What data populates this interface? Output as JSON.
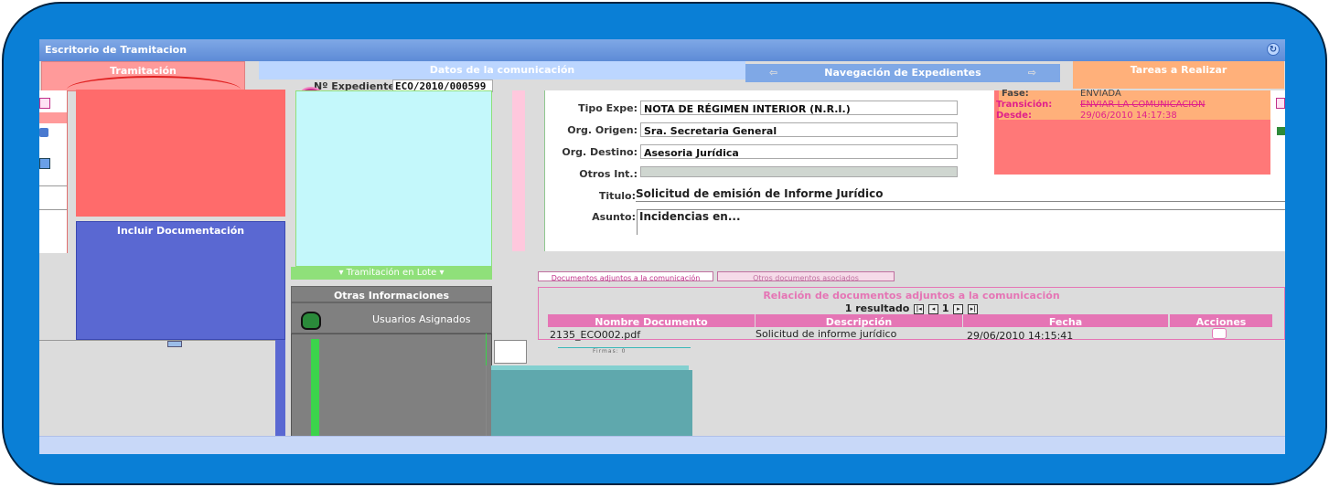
{
  "window": {
    "title": "Escritorio de Tramitacion"
  },
  "panels": {
    "tramitacion": "Tramitación",
    "datos": "Datos de la comunicación",
    "navegacion": "Navegación de Expedientes",
    "tareas": "Tareas a Realizar",
    "incluir": "Incluir Documentación",
    "lote": "▾ Tramitación en Lote ▾",
    "otras": "Otras Informaciones",
    "usuarios": "Usuarios Asignados"
  },
  "expediente": {
    "label": "Nº Expediente:",
    "value": "ECO/2010/000599"
  },
  "form": {
    "tipo_label": "Tipo Expe:",
    "tipo_value": "NOTA DE RÉGIMEN INTERIOR (N.R.I.)",
    "origen_label": "Org. Origen:",
    "origen_value": "Sra. Secretaria General",
    "destino_label": "Org. Destino:",
    "destino_value": "Asesoria Jurídica",
    "otros_label": "Otros Int.:",
    "otros_value": "",
    "titulo_label": "Titulo:",
    "titulo_value": "Solicitud de emisión de Informe Jurídico",
    "asunto_label": "Asunto:",
    "asunto_value": "Incidencias en..."
  },
  "tareas": {
    "fase_label": "Fase:",
    "fase_value": "ENVIADA",
    "transicion_label": "Transición:",
    "transicion_value": "ENVIAR LA COMUNICACION",
    "desde_label": "Desde:",
    "desde_value": "29/06/2010 14:17:38"
  },
  "docs": {
    "tab1": "Documentos adjuntos a la comunicación",
    "tab2": "Otros documentos asociados",
    "caption": "Relación de documentos adjuntos a la comunicación",
    "resultados": "1 resultado",
    "page": "1",
    "headers": [
      "Nombre Documento",
      "Descripción",
      "Fecha",
      "Acciones"
    ],
    "rows": [
      {
        "nombre": "2135_ECO002.pdf",
        "descripcion": "Solicitud de informe jurídico",
        "fecha": "29/06/2010 14:15:41"
      }
    ],
    "footer": "Firmas: 0"
  },
  "colors": {
    "frame": "#0a7fd6",
    "title": "#5d8bd6",
    "red": "#ff6b6b",
    "blue": "#5a68d2",
    "cyan": "#c4f8fb",
    "green": "#8fe07a",
    "teal": "#5fa8ad",
    "pink": "#e575b5",
    "orange": "#ffb07a"
  }
}
